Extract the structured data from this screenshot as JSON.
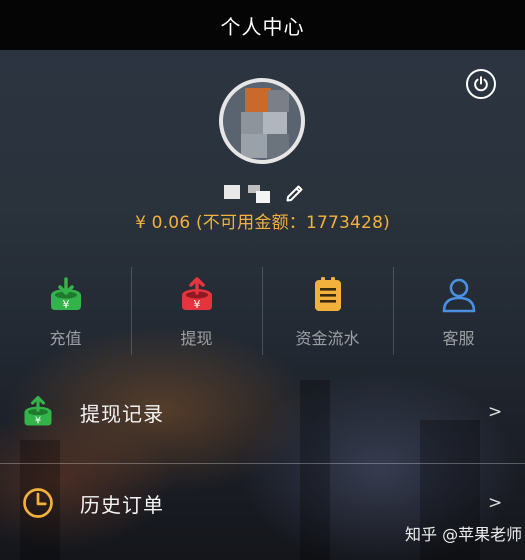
{
  "header": {
    "title": "个人中心"
  },
  "profile": {
    "balance": "¥ 0.06 (不可用金额：1773428)"
  },
  "actions": [
    {
      "label": "充值",
      "icon": "deposit-icon",
      "color": "#34b34a"
    },
    {
      "label": "提现",
      "icon": "withdraw-icon",
      "color": "#e5343d"
    },
    {
      "label": "资金流水",
      "icon": "ledger-icon",
      "color": "#f2b13c"
    },
    {
      "label": "客服",
      "icon": "user-icon",
      "color": "#4a90e2"
    }
  ],
  "menu": [
    {
      "label": "提现记录",
      "chevron": ">",
      "icon": "withdraw-record-icon"
    },
    {
      "label": "历史订单",
      "chevron": ">",
      "icon": "clock-icon"
    }
  ],
  "watermark": "知乎 @苹果老师",
  "colors": {
    "accent": "#f2b13c",
    "header_bg": "#050505"
  }
}
